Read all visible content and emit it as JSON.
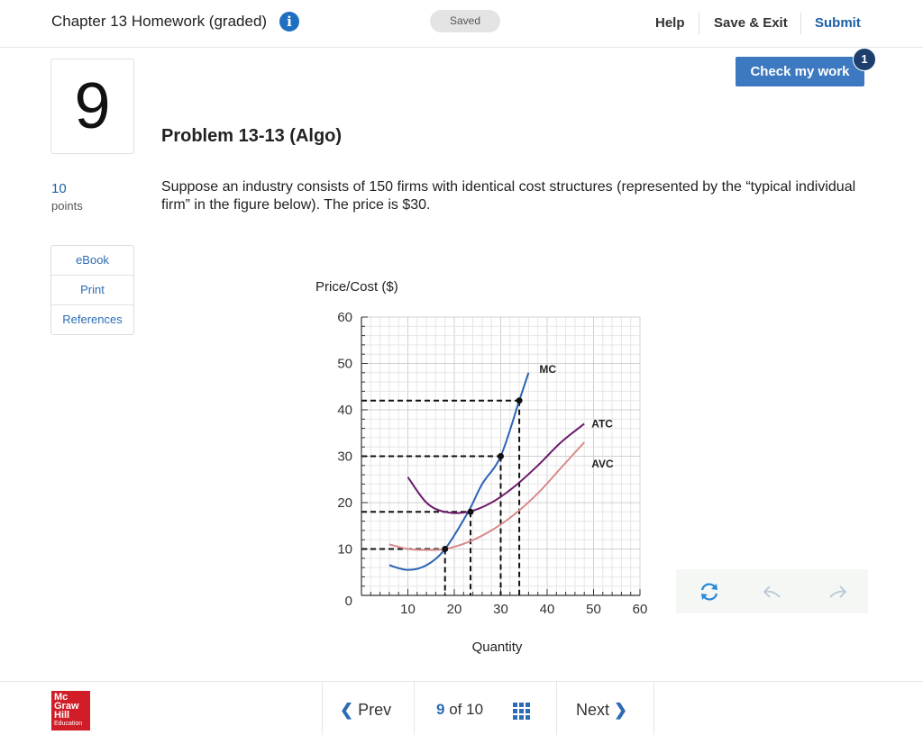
{
  "header": {
    "title": "Chapter 13 Homework (graded)",
    "info_icon": "info-icon",
    "saved_label": "Saved",
    "help": "Help",
    "save_exit": "Save & Exit",
    "submit": "Submit"
  },
  "problem": {
    "number": "9",
    "points_value": "10",
    "points_label": "points",
    "title": "Problem 13-13 (Algo)",
    "text": "Suppose an industry consists of 150 firms with identical cost structures (represented by the “typical individual firm” in the figure below). The price is $30."
  },
  "side_tools": [
    "eBook",
    "Print",
    "References"
  ],
  "check": {
    "label": "Check my work",
    "badge": "1"
  },
  "graph_tools": [
    "refresh-icon",
    "undo-icon",
    "redo-icon"
  ],
  "footer": {
    "logo_lines": [
      "Mc",
      "Graw",
      "Hill"
    ],
    "logo_sub": "Education",
    "prev": "Prev",
    "next": "Next",
    "current_page": "9",
    "of_label": "of",
    "total_pages": "10"
  },
  "colors": {
    "accent": "#2b6cb5",
    "mc": "#2a62b5",
    "atc": "#6b1a6b",
    "avc": "#d98a8a",
    "logo": "#d01d28"
  },
  "chart_data": {
    "type": "line",
    "ylabel": "Price/Cost ($)",
    "xlabel": "Quantity",
    "xlim": [
      0,
      60
    ],
    "ylim": [
      0,
      60
    ],
    "xticks": [
      10,
      20,
      30,
      40,
      50,
      60
    ],
    "yticks": [
      10,
      20,
      30,
      40,
      50,
      60
    ],
    "origin_label": "0",
    "grid": true,
    "series": [
      {
        "name": "MC",
        "color": "#2a62b5",
        "x": [
          6,
          10,
          14,
          18,
          23,
          26,
          30,
          34,
          36
        ],
        "y": [
          6.5,
          5.5,
          6.5,
          10,
          18,
          24,
          30,
          42,
          48
        ]
      },
      {
        "name": "ATC",
        "color": "#6b1a6b",
        "x": [
          10,
          14,
          18,
          23,
          28,
          33,
          38,
          43,
          48
        ],
        "y": [
          25.5,
          20,
          18,
          18,
          20,
          23.5,
          28,
          33,
          37
        ]
      },
      {
        "name": "AVC",
        "color": "#d98a8a",
        "x": [
          6,
          10,
          14,
          18,
          23,
          28,
          33,
          38,
          43,
          48
        ],
        "y": [
          11,
          10,
          9.8,
          10,
          11.5,
          14,
          17.5,
          22,
          27.5,
          33
        ]
      }
    ],
    "points": [
      {
        "x": 18,
        "y": 10
      },
      {
        "x": 23.5,
        "y": 18
      },
      {
        "x": 30,
        "y": 30
      },
      {
        "x": 34,
        "y": 42
      }
    ]
  }
}
